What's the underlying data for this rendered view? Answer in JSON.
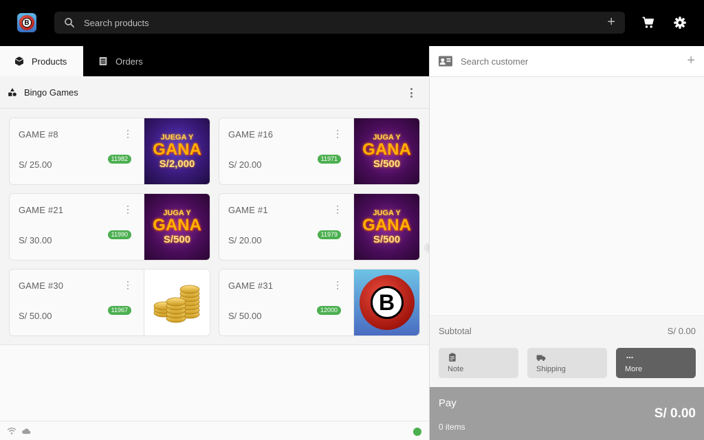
{
  "app": {
    "logo_letter": "B",
    "search": {
      "placeholder": "Search products"
    },
    "icons": {
      "search": "search-icon",
      "add": "plus-icon",
      "cart": "cart-icon",
      "settings": "gear-icon"
    }
  },
  "tabs": [
    {
      "label": "Products",
      "icon": "box-icon",
      "active": true
    },
    {
      "label": "Orders",
      "icon": "receipt-icon",
      "active": false
    }
  ],
  "category": {
    "title": "Bingo Games",
    "icon": "shapes-icon"
  },
  "products": [
    {
      "name": "GAME #8",
      "price": "S/ 25.00",
      "stock": "11982",
      "image": {
        "type": "gana",
        "line1": "JUEGA Y",
        "line2": "GANA",
        "line3": "S/2,000"
      }
    },
    {
      "name": "GAME #16",
      "price": "S/ 20.00",
      "stock": "11971",
      "image": {
        "type": "gana",
        "line1": "JUGA Y",
        "line2": "GANA",
        "line3": "S/500"
      }
    },
    {
      "name": "GAME #21",
      "price": "S/ 30.00",
      "stock": "11990",
      "image": {
        "type": "gana",
        "line1": "JUGA Y",
        "line2": "GANA",
        "line3": "S/500"
      }
    },
    {
      "name": "GAME #1",
      "price": "S/ 20.00",
      "stock": "11979",
      "image": {
        "type": "gana",
        "line1": "JUGA Y",
        "line2": "GANA",
        "line3": "S/500"
      }
    },
    {
      "name": "GAME #30",
      "price": "S/ 50.00",
      "stock": "11967",
      "image": {
        "type": "coins"
      }
    },
    {
      "name": "GAME #31",
      "price": "S/ 50.00",
      "stock": "12000",
      "image": {
        "type": "bingo",
        "letter": "B"
      }
    }
  ],
  "status": {
    "wifi": "wifi-icon",
    "cloud": "cloud-icon",
    "online_color": "#4caf50"
  },
  "customer": {
    "placeholder": "Search customer"
  },
  "summary": {
    "subtotal_label": "Subtotal",
    "subtotal_value": "S/ 0.00",
    "actions": [
      {
        "label": "Note",
        "icon": "clipboard-icon"
      },
      {
        "label": "Shipping",
        "icon": "truck-icon"
      },
      {
        "label": "More",
        "icon": "more-icon"
      }
    ]
  },
  "pay": {
    "label": "Pay",
    "items": "0 items",
    "total": "S/ 0.00"
  },
  "colors": {
    "badge": "#4caf50",
    "pay_bg": "#9e9e9e",
    "more_bg": "#616161"
  }
}
